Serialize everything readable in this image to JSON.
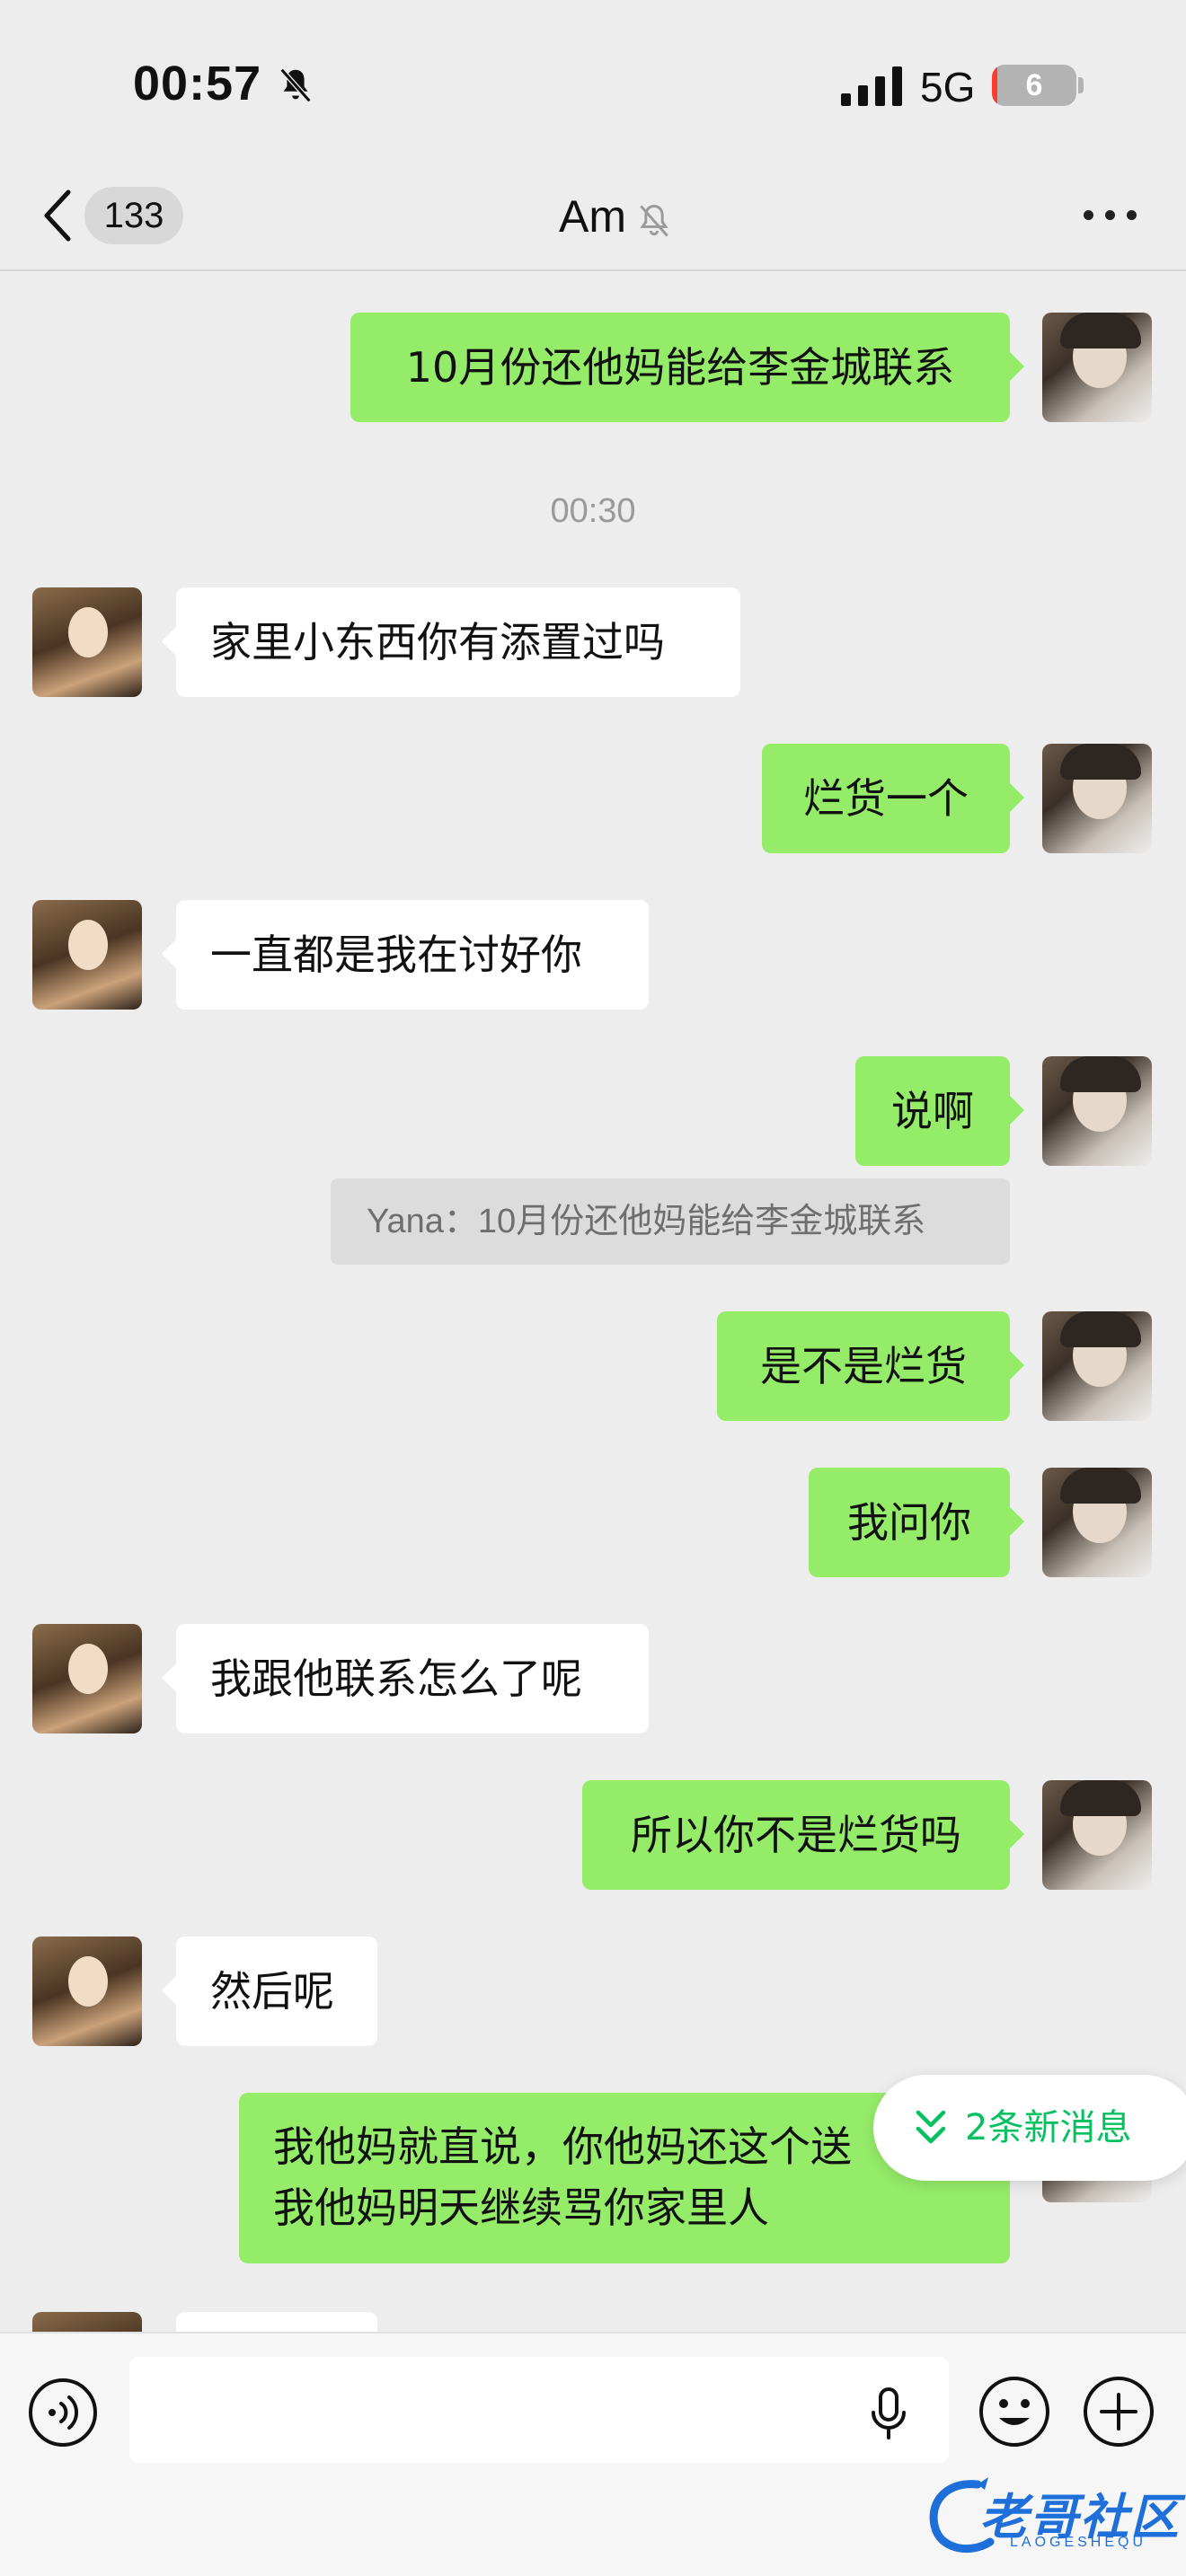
{
  "status_bar": {
    "time": "00:57",
    "network": "5G",
    "battery": "6",
    "battery_level": 0.06
  },
  "nav": {
    "unread_count": "133",
    "title": "Am"
  },
  "timestamp": "00:30",
  "messages": [
    {
      "from": "me",
      "text": "10月份还他妈能给李金城联系"
    },
    {
      "from": "other",
      "text": "家里小东西你有添置过吗"
    },
    {
      "from": "me",
      "text": "烂货一个"
    },
    {
      "from": "other",
      "text": "一直都是我在讨好你"
    },
    {
      "from": "me",
      "text": "说啊"
    },
    {
      "from": "me",
      "text": "是不是烂货"
    },
    {
      "from": "me",
      "text": "我问你"
    },
    {
      "from": "other",
      "text": "我跟他联系怎么了呢"
    },
    {
      "from": "me",
      "text": "所以你不是烂货吗"
    },
    {
      "from": "other",
      "text": "然后呢"
    },
    {
      "from": "me",
      "lines": [
        "我他妈就直说，你他妈还这个送",
        "我他妈明天继续骂你家里人"
      ]
    }
  ],
  "quote": "Yana：10月份还他妈能给李金城联系",
  "new_messages": "2条新消息",
  "input": {
    "value": "",
    "placeholder": ""
  },
  "watermark": {
    "text": "老哥社区",
    "sub": "LAOGESHEQU"
  },
  "colors": {
    "my_bubble": "#95ec69",
    "their_bubble": "#ffffff",
    "background": "#ededed",
    "accent": "#07c160"
  },
  "icons": [
    "back-icon",
    "mute-bell-icon",
    "more-icon",
    "chevron-down-double-icon",
    "voice-icon",
    "microphone-icon",
    "emoji-icon",
    "plus-icon"
  ]
}
